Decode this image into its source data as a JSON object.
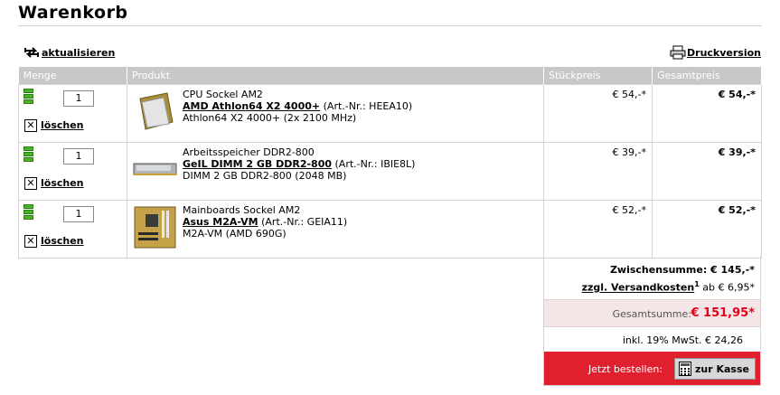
{
  "page": {
    "title": "Warenkorb"
  },
  "actions": {
    "refresh_label": "aktualisieren",
    "print_label": "Druckversion"
  },
  "table": {
    "headers": {
      "qty": "Menge",
      "product": "Produkt",
      "unit_price": "Stückpreis",
      "total_price": "Gesamtpreis"
    },
    "delete_label": "löschen",
    "rows": [
      {
        "qty": "1",
        "category": "CPU Sockel AM2",
        "name": "AMD Athlon64 X2 4000+",
        "art": " (Art.-Nr.: HEEA10)",
        "desc": "Athlon64 X2 4000+ (2x 2100 MHz)",
        "unit_price": "€ 54,-*",
        "total_price": "€ 54,-*",
        "image": "cpu-image"
      },
      {
        "qty": "1",
        "category": "Arbeitsspeicher DDR2-800",
        "name": "GeIL DIMM 2 GB DDR2-800",
        "art": " (Art.-Nr.: IBIE8L)",
        "desc": "DIMM 2 GB DDR2-800 (2048 MB)",
        "unit_price": "€ 39,-*",
        "total_price": "€ 39,-*",
        "image": "ram-image"
      },
      {
        "qty": "1",
        "category": "Mainboards Sockel AM2",
        "name": "Asus M2A-VM",
        "art": " (Art.-Nr.: GEIA11)",
        "desc": "M2A-VM (AMD 690G)",
        "unit_price": "€ 52,-*",
        "total_price": "€ 52,-*",
        "image": "mainboard-image"
      }
    ]
  },
  "summary": {
    "subtotal": "Zwischensumme: € 145,-*",
    "shipping_link": "zzgl. Versandkosten",
    "shipping_sup": "1",
    "shipping_value": " ab € 6,95*",
    "total_label": "Gesamtsumme:",
    "total_value": "€ 151,95*",
    "vat": "inkl. 19% MwSt. € 24,26",
    "order_label": "Jetzt bestellen:",
    "checkout_label": "zur Kasse"
  },
  "colors": {
    "accent_red": "#e2001a",
    "order_band": "#e0202f",
    "qty_bar_green": "#4caf2c",
    "header_gray": "#c8c8c8"
  }
}
